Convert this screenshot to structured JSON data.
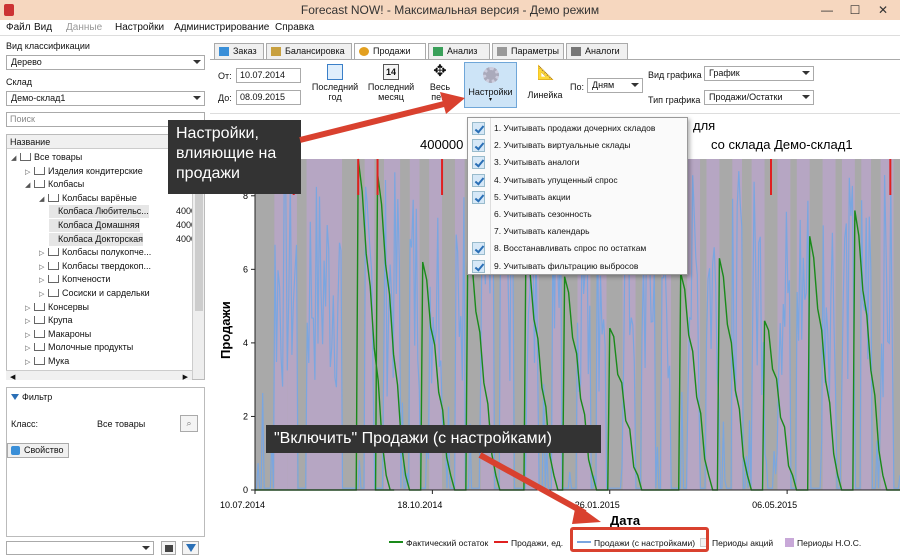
{
  "window": {
    "title": "Forecast NOW! - Максимальная версия - Демо режим",
    "min": "—",
    "max": "☐",
    "close": "✕"
  },
  "menu": [
    "Файл",
    "Вид",
    "Данные",
    "Настройки",
    "Администрирование",
    "Справка"
  ],
  "sidebar": {
    "classification_label": "Вид классификации",
    "classification_value": "Дерево",
    "warehouse_label": "Склад",
    "warehouse_value": "Демо-склад1",
    "search_placeholder": "Поиск",
    "tree_header": "Название",
    "tree": [
      {
        "label": "Все товары",
        "level": 0,
        "exp": "◢"
      },
      {
        "label": "Изделия кондитерские",
        "level": 1,
        "exp": "▷"
      },
      {
        "label": "Колбасы",
        "level": 1,
        "exp": "◢"
      },
      {
        "label": "Колбасы варёные",
        "level": 2,
        "exp": "◢"
      },
      {
        "label": "Колбаса Любительс...",
        "level": 3,
        "exp": "",
        "num": "4000"
      },
      {
        "label": "Колбаса Домашняя",
        "level": 3,
        "exp": "",
        "num": "4000"
      },
      {
        "label": "Колбаса Докторская",
        "level": 3,
        "exp": "",
        "num": "4000"
      },
      {
        "label": "Колбасы полукопче...",
        "level": 2,
        "exp": "▷"
      },
      {
        "label": "Колбасы твердокоп...",
        "level": 2,
        "exp": "▷"
      },
      {
        "label": "Копчености",
        "level": 2,
        "exp": "▷"
      },
      {
        "label": "Сосиски и сардельки",
        "level": 2,
        "exp": "▷"
      },
      {
        "label": "Консервы",
        "level": 1,
        "exp": "▷"
      },
      {
        "label": "Крупа",
        "level": 1,
        "exp": "▷"
      },
      {
        "label": "Макароны",
        "level": 1,
        "exp": "▷"
      },
      {
        "label": "Молочные продукты",
        "level": 1,
        "exp": "▷"
      },
      {
        "label": "Мука",
        "level": 1,
        "exp": "▷"
      }
    ],
    "filter_title": "Фильтр",
    "class_label": "Класс:",
    "class_value": "Все товары",
    "property_button": "Свойство"
  },
  "tabs": [
    "Заказ",
    "Балансировка",
    "Продажи",
    "Анализ",
    "Параметры",
    "Аналоги"
  ],
  "active_tab": "Продажи",
  "toolbar": {
    "from_label": "От:",
    "from_value": "10.07.2014",
    "to_label": "До:",
    "to_value": "08.09.2015",
    "last_year": "Последний год",
    "last_year_l1": "Последний",
    "last_year_l2": "год",
    "last_month_l1": "Последний",
    "last_month_l2": "месяц",
    "calendar_day": "14",
    "all_period_l1": "Весь",
    "all_period_l2": "пе...",
    "settings": "Настройки",
    "ruler": "Линейка",
    "by_label": "По:",
    "by_value": "Дням",
    "chart_view_label": "Вид графика",
    "chart_view_value": "График",
    "chart_type_label": "Тип графика",
    "chart_type_value": "Продажи/Остатки"
  },
  "settings_menu": [
    {
      "label": "1. Учитывать продажи дочерних складов",
      "checked": true
    },
    {
      "label": "2. Учитывать виртуальные склады",
      "checked": true
    },
    {
      "label": "3. Учитывать аналоги",
      "checked": true
    },
    {
      "label": "4. Учитывать упущенный спрос",
      "checked": true
    },
    {
      "label": "5. Учитывать акции",
      "checked": true
    },
    {
      "label": "6. Учитывать сезонность",
      "checked": false
    },
    {
      "label": "7. Учитывать календарь",
      "checked": false
    },
    {
      "label": "8. Восстанавливать спрос по остаткам",
      "checked": true
    },
    {
      "label": "9. Учитывать фильтрацию выбросов",
      "checked": true
    }
  ],
  "callouts": {
    "settings_note": "Настройки, влияющие на продажи",
    "enable_note": "\"Включить\" Продажи (с настройками)"
  },
  "chart_data": {
    "type": "line",
    "title_line1_fragment": "для",
    "title_line2_prefix": "400000",
    "title_line2_suffix": "со склада Демо-склад1",
    "ylabel": "Продажи",
    "xlabel": "Дата",
    "ylim": [
      0,
      9
    ],
    "yticks": [
      0,
      2,
      4,
      6,
      8
    ],
    "xticks": [
      "10.07.2014",
      "18.10.2014",
      "26.01.2015",
      "06.05.2015"
    ],
    "legend": [
      {
        "label": "Фактический остаток",
        "color": "#1a8a1a",
        "kind": "line"
      },
      {
        "label": "Продажи, ед.",
        "color": "#e02020",
        "kind": "line"
      },
      {
        "label": "Продажи (с настройками)",
        "color": "#7aa6e0",
        "kind": "line"
      },
      {
        "label": "Периоды акций",
        "color": "#f2f2f2",
        "kind": "box"
      },
      {
        "label": "Периоды Н.О.С.",
        "color": "#c8a8d8",
        "kind": "box"
      }
    ],
    "background": "#a9a9a9",
    "stock_peaks": [
      {
        "x": 0.16,
        "peak": 9
      },
      {
        "x": 0.19,
        "peak": 8.6
      },
      {
        "x": 0.26,
        "peak": 6.2
      },
      {
        "x": 0.33,
        "peak": 6.8
      },
      {
        "x": 0.42,
        "peak": 6.5
      },
      {
        "x": 0.48,
        "peak": 5.8
      },
      {
        "x": 0.55,
        "peak": 4.4
      },
      {
        "x": 0.66,
        "peak": 5.9
      },
      {
        "x": 0.72,
        "peak": 6.3
      },
      {
        "x": 0.79,
        "peak": 4.6
      },
      {
        "x": 0.86,
        "peak": 6.9
      },
      {
        "x": 0.93,
        "peak": 7.6
      }
    ],
    "red_spikes_x": [
      0.06,
      0.16,
      0.19,
      0.29,
      0.8,
      0.985
    ]
  }
}
